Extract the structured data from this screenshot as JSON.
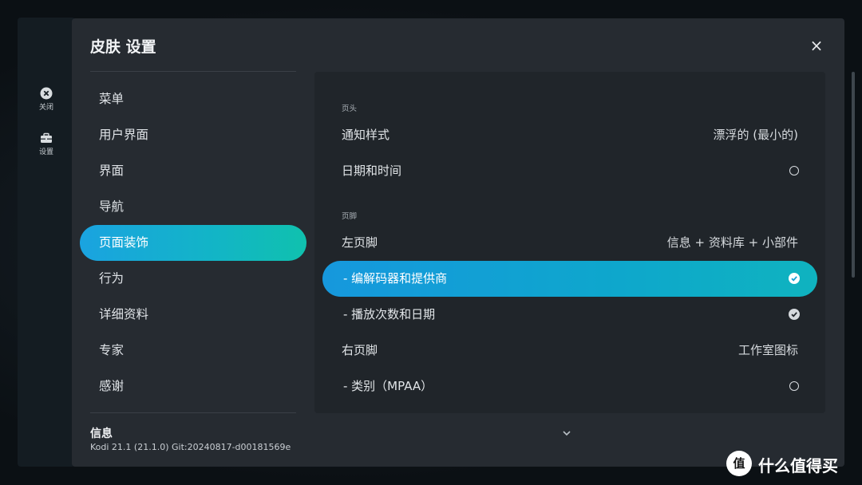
{
  "rail": {
    "close_label": "关闭",
    "settings_label": "设置"
  },
  "dialog": {
    "title": "皮肤 设置",
    "close_glyph": "×"
  },
  "nav": {
    "items": [
      {
        "label": "菜单"
      },
      {
        "label": "用户界面"
      },
      {
        "label": "界面"
      },
      {
        "label": "导航"
      },
      {
        "label": "页面装饰",
        "active": true
      },
      {
        "label": "行为"
      },
      {
        "label": "详细资料"
      },
      {
        "label": "专家"
      },
      {
        "label": "感谢"
      }
    ]
  },
  "info": {
    "title": "信息",
    "version": "Kodi 21.1 (21.1.0) Git:20240817-d00181569e"
  },
  "settings": {
    "header_section": "页头",
    "footer_section": "页脚",
    "rows": [
      {
        "label": "通知样式",
        "value": "漂浮的 (最小的)"
      },
      {
        "label": "日期和时间",
        "state": "off"
      },
      {
        "label": "左页脚",
        "value": "信息 + 资料库 + 小部件"
      },
      {
        "label": "- 编解码器和提供商",
        "state": "on",
        "focused": true
      },
      {
        "label": "- 播放次数和日期",
        "state": "on"
      },
      {
        "label": "右页脚",
        "value": "工作室图标"
      },
      {
        "label": "- 类别（MPAA）",
        "state": "off"
      }
    ]
  },
  "watermark": {
    "logo_glyph": "值",
    "text": "什么值得买"
  },
  "colors": {
    "accent_start": "#1aa3e0",
    "accent_end": "#10c1ae",
    "dialog_bg": "#262b31",
    "panel_bg": "#20252a"
  }
}
